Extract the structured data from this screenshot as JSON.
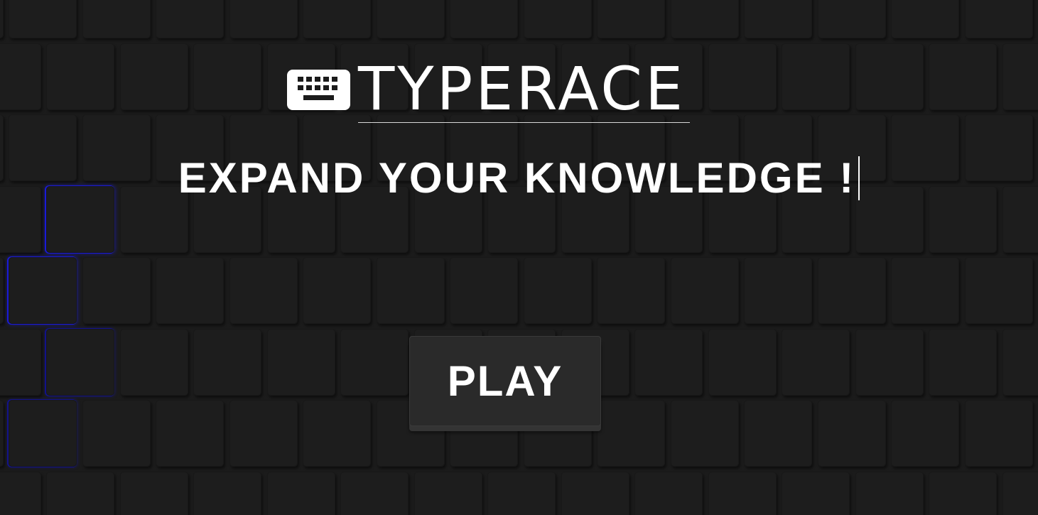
{
  "brand": {
    "title": "TYPERACE",
    "icon": "keyboard-icon"
  },
  "hero": {
    "tagline": "EXPAND YOUR KNOWLEDGE !"
  },
  "actions": {
    "play_label": "PLAY"
  },
  "colors": {
    "background": "#1b1b1b",
    "text": "#ffffff",
    "accent_glow": "#1a1ad8",
    "button": "#2a2a2a"
  }
}
